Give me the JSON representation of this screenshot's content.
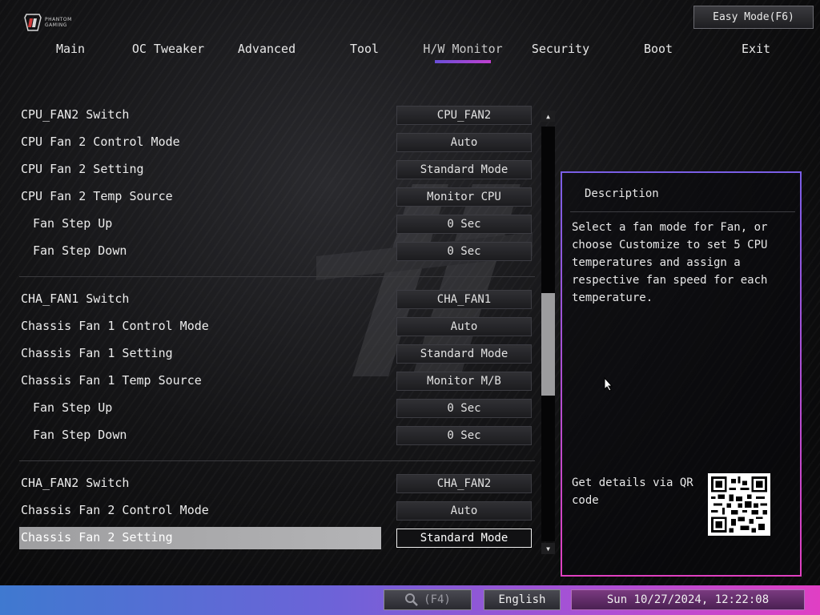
{
  "header": {
    "logo_text_line1": "PHANTOM",
    "logo_text_line2": "GAMING",
    "easy_mode_label": "Easy Mode(F6)"
  },
  "tabs": [
    {
      "label": "Main",
      "active": false
    },
    {
      "label": "OC Tweaker",
      "active": false
    },
    {
      "label": "Advanced",
      "active": false
    },
    {
      "label": "Tool",
      "active": false
    },
    {
      "label": "H/W Monitor",
      "active": true
    },
    {
      "label": "Security",
      "active": false
    },
    {
      "label": "Boot",
      "active": false
    },
    {
      "label": "Exit",
      "active": false
    }
  ],
  "settings": [
    {
      "label": "CPU_FAN2 Switch",
      "value": "CPU_FAN2"
    },
    {
      "label": "CPU Fan 2 Control Mode",
      "value": "Auto"
    },
    {
      "label": "CPU Fan 2 Setting",
      "value": "Standard Mode"
    },
    {
      "label": "CPU Fan 2 Temp Source",
      "value": "Monitor CPU"
    },
    {
      "label": "Fan Step Up",
      "value": "0 Sec"
    },
    {
      "label": "Fan Step Down",
      "value": "0 Sec"
    },
    {
      "label": "CHA_FAN1 Switch",
      "value": "CHA_FAN1"
    },
    {
      "label": "Chassis Fan 1 Control Mode",
      "value": "Auto"
    },
    {
      "label": "Chassis Fan 1 Setting",
      "value": "Standard Mode"
    },
    {
      "label": "Chassis Fan 1 Temp Source",
      "value": "Monitor M/B"
    },
    {
      "label": "Fan Step Up",
      "value": "0 Sec"
    },
    {
      "label": "Fan Step Down",
      "value": "0 Sec"
    },
    {
      "label": "CHA_FAN2 Switch",
      "value": "CHA_FAN2"
    },
    {
      "label": "Chassis Fan 2 Control Mode",
      "value": "Auto"
    },
    {
      "label": "Chassis Fan 2 Setting",
      "value": "Standard Mode"
    }
  ],
  "description": {
    "title": "Description",
    "text": "Select a fan mode for Fan, or choose Customize to set 5 CPU temperatures and assign a respective fan speed for each temperature.",
    "qr_label": "Get details via QR code"
  },
  "bottom_bar": {
    "search_key": "(F4)",
    "language": "English",
    "datetime": "Sun 10/27/2024, 12:22:08"
  },
  "colors": {
    "accent_start": "#6a4fd8",
    "accent_end": "#c040d0",
    "panel_border_top": "#7a5ee6",
    "panel_border_bottom": "#e040c0",
    "selected_row": "#a8a8aa"
  }
}
